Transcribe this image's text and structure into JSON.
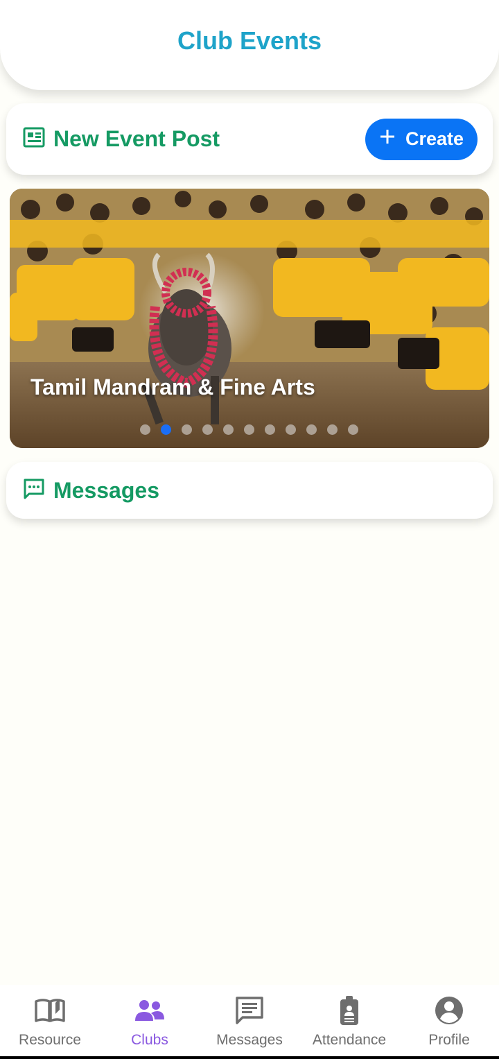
{
  "header": {
    "title": "Club Events"
  },
  "event_post": {
    "title": "New Event Post",
    "icon": "newspaper-icon",
    "create_button": {
      "label": "Create",
      "icon": "plus-icon"
    }
  },
  "carousel": {
    "slide_title": "Tamil Mandram & Fine Arts",
    "image": "jallikattu bull-taming festival photo",
    "dot_count": 11,
    "active_index": 1
  },
  "messages": {
    "title": "Messages",
    "icon": "chat-bubble-icon"
  },
  "bottom_nav": {
    "items": [
      {
        "label": "Resource",
        "icon": "book-open-icon",
        "active": false
      },
      {
        "label": "Clubs",
        "icon": "people-icon",
        "active": true
      },
      {
        "label": "Messages",
        "icon": "message-icon",
        "active": false
      },
      {
        "label": "Attendance",
        "icon": "id-badge-icon",
        "active": false
      },
      {
        "label": "Profile",
        "icon": "account-circle-icon",
        "active": false
      }
    ]
  },
  "colors": {
    "header_title": "#1ea3c9",
    "card_title": "#159a63",
    "create_button": "#0a74f5",
    "nav_active": "#8a59e0",
    "nav_inactive": "#6e6e6e",
    "dot_active": "#1b6ef5"
  }
}
